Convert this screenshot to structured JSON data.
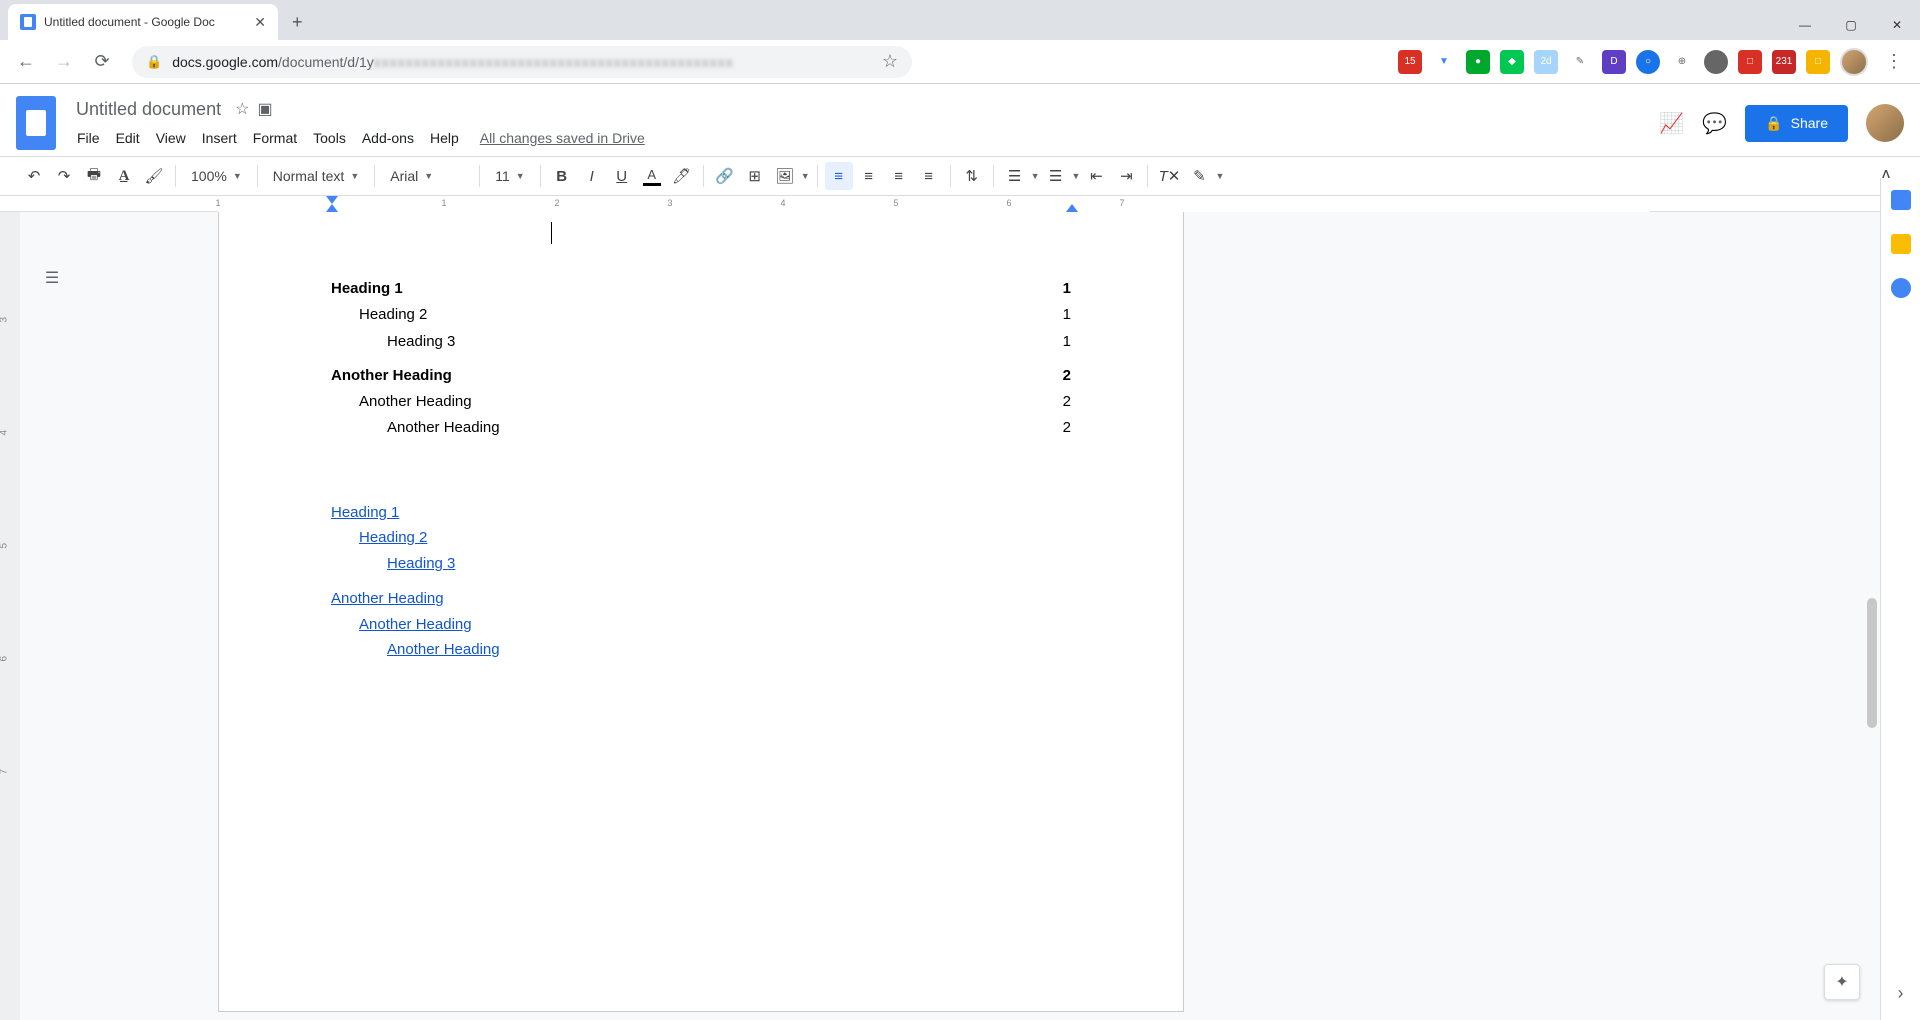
{
  "browser": {
    "tab_title": "Untitled document - Google Doc",
    "url_prefix": "docs.google.com",
    "url_path": "/document/d/1y",
    "url_blurred": "xxxxxxxxxxxxxxxxxxxxxxxxxxxxxxxxxxxxxxxxxxxxx"
  },
  "header": {
    "doc_title": "Untitled document",
    "menus": [
      "File",
      "Edit",
      "View",
      "Insert",
      "Format",
      "Tools",
      "Add-ons",
      "Help"
    ],
    "save_status": "All changes saved in Drive",
    "share_label": "Share"
  },
  "toolbar": {
    "zoom": "100%",
    "style": "Normal text",
    "font": "Arial",
    "font_size": "11"
  },
  "ruler": {
    "marks": [
      "1",
      "1",
      "2",
      "3",
      "4",
      "5",
      "6",
      "7"
    ]
  },
  "toc": {
    "rows": [
      {
        "level": 1,
        "text": "Heading 1",
        "page": "1"
      },
      {
        "level": 2,
        "text": "Heading 2",
        "page": "1"
      },
      {
        "level": 3,
        "text": "Heading 3",
        "page": "1"
      },
      {
        "level": 1,
        "text": "Another Heading",
        "page": "2"
      },
      {
        "level": 2,
        "text": "Another Heading",
        "page": "2"
      },
      {
        "level": 3,
        "text": "Another Heading",
        "page": "2"
      }
    ],
    "links": [
      {
        "level": 1,
        "text": "Heading 1"
      },
      {
        "level": 2,
        "text": "Heading 2"
      },
      {
        "level": 3,
        "text": "Heading 3"
      },
      {
        "level": 1,
        "text": "Another Heading"
      },
      {
        "level": 2,
        "text": "Another Heading"
      },
      {
        "level": 3,
        "text": "Another Heading"
      }
    ]
  },
  "v_ruler": [
    "3",
    "4",
    "5",
    "6",
    "7"
  ]
}
